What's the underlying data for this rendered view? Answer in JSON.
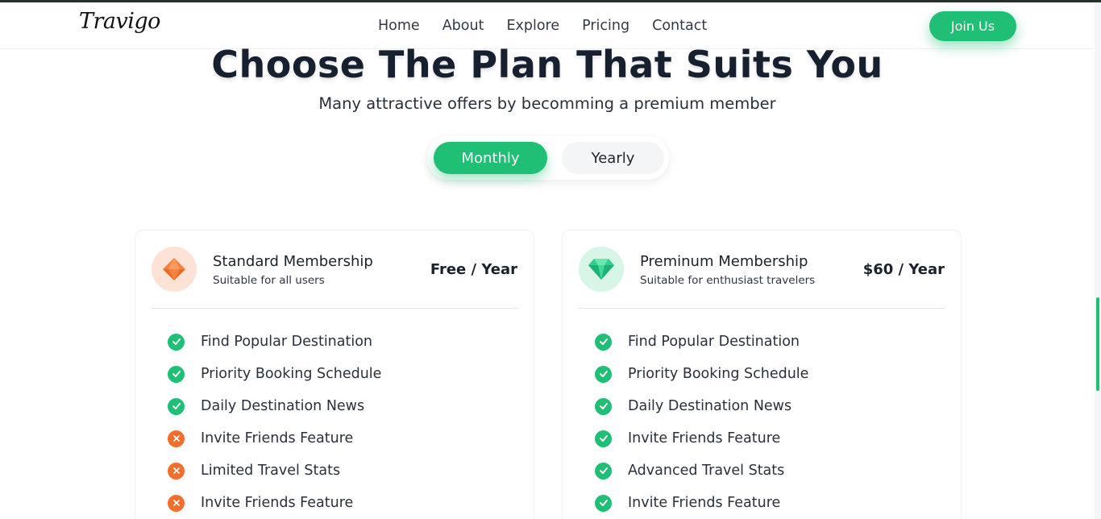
{
  "brand": {
    "logo_text": "Travigo",
    "accent_color": "#1fbf75",
    "negative_color": "#f26e2b"
  },
  "nav": {
    "links": [
      "Home",
      "About",
      "Explore",
      "Pricing",
      "Contact"
    ],
    "cta_label": "Join Us"
  },
  "hero": {
    "title": "Choose The Plan That Suits You",
    "subtitle": "Many attractive offers by becomming a premium member"
  },
  "billing_toggle": {
    "options": [
      "Monthly",
      "Yearly"
    ],
    "selected": "Monthly"
  },
  "plans": [
    {
      "name": "Standard Membership",
      "subtitle": "Suitable for all users",
      "price": "Free / Year",
      "icon": "orange-diamond-icon",
      "features": [
        {
          "label": "Find Popular Destination",
          "included": true
        },
        {
          "label": "Priority Booking Schedule",
          "included": true
        },
        {
          "label": "Daily Destination News",
          "included": true
        },
        {
          "label": "Invite Friends Feature",
          "included": false
        },
        {
          "label": "Limited Travel Stats",
          "included": false
        },
        {
          "label": "Invite Friends Feature",
          "included": false
        }
      ]
    },
    {
      "name": "Preminum Membership",
      "subtitle": "Suitable for enthusiast travelers",
      "price": "$60 / Year",
      "icon": "green-diamond-icon",
      "features": [
        {
          "label": "Find Popular Destination",
          "included": true
        },
        {
          "label": "Priority Booking Schedule",
          "included": true
        },
        {
          "label": "Daily Destination News",
          "included": true
        },
        {
          "label": "Invite Friends Feature",
          "included": true
        },
        {
          "label": "Advanced Travel Stats",
          "included": true
        },
        {
          "label": "Invite Friends Feature",
          "included": true
        }
      ]
    }
  ]
}
